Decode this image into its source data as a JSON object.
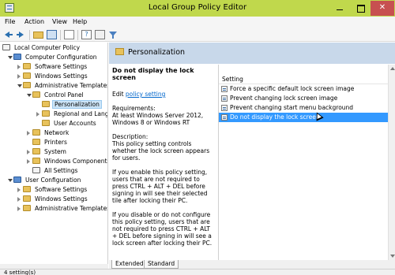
{
  "window": {
    "title": "Local Group Policy Editor"
  },
  "menubar": {
    "items": [
      "File",
      "Action",
      "View",
      "Help"
    ]
  },
  "tree": {
    "nodes": [
      {
        "label": "Local Computer Policy"
      },
      {
        "label": "Computer Configuration"
      },
      {
        "label": "Software Settings"
      },
      {
        "label": "Windows Settings"
      },
      {
        "label": "Administrative Templates"
      },
      {
        "label": "Control Panel"
      },
      {
        "label": "Personalization"
      },
      {
        "label": "Regional and Language Options"
      },
      {
        "label": "User Accounts"
      },
      {
        "label": "Network"
      },
      {
        "label": "Printers"
      },
      {
        "label": "System"
      },
      {
        "label": "Windows Components"
      },
      {
        "label": "All Settings"
      },
      {
        "label": "User Configuration"
      },
      {
        "label": "Software Settings"
      },
      {
        "label": "Windows Settings"
      },
      {
        "label": "Administrative Templates"
      }
    ]
  },
  "header": {
    "title": "Personalization"
  },
  "description": {
    "heading": "Do not display the lock screen",
    "edit_prefix": "Edit ",
    "edit_link": "policy setting",
    "requirements": "Requirements:\nAt least Windows Server 2012, Windows 8 or Windows RT",
    "description": "Description:\nThis policy setting controls whether the lock screen appears for users.",
    "para1": "If you enable this policy setting, users that are not required to press CTRL + ALT + DEL before signing in will see their selected tile after locking their PC.",
    "para2": "If you disable or do not configure this policy setting, users that are not required to press CTRL + ALT + DEL before signing in will see a lock screen after locking their PC."
  },
  "list": {
    "column": "Setting",
    "rows": [
      {
        "label": "Force a specific default lock screen image"
      },
      {
        "label": "Prevent changing lock screen image"
      },
      {
        "label": "Prevent changing start menu background"
      },
      {
        "label": "Do not display the lock screen",
        "selected": true
      }
    ]
  },
  "tabs": [
    "Extended",
    "Standard"
  ],
  "status": {
    "text": "4 setting(s)"
  },
  "colors": {
    "titlebar": "#c0d84c",
    "header": "#c8d8ea",
    "selection": "#3399ff",
    "link": "#0066cc",
    "tree_selection": "#cce4f7"
  }
}
